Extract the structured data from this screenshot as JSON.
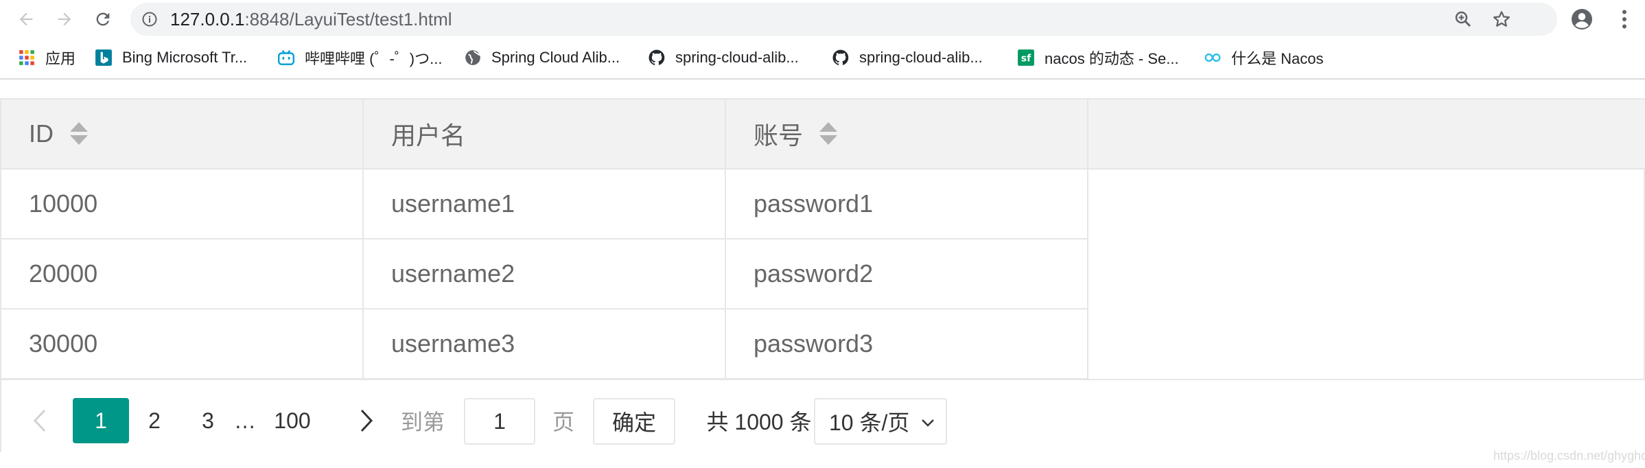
{
  "browser": {
    "url_host": "127.0.0.1",
    "url_path": ":8848/LayuiTest/test1.html"
  },
  "bookmarks": [
    {
      "label": "应用",
      "icon": "apps-grid-icon"
    },
    {
      "label": "Bing Microsoft Tr...",
      "icon": "bing-icon"
    },
    {
      "label": "哔哩哔哩 (゜-゜)つ...",
      "icon": "bilibili-icon"
    },
    {
      "label": "Spring Cloud Alib...",
      "icon": "globe-icon"
    },
    {
      "label": "spring-cloud-alib...",
      "icon": "github-icon"
    },
    {
      "label": "spring-cloud-alib...",
      "icon": "github-icon"
    },
    {
      "label": "nacos 的动态 - Se...",
      "icon": "segmentfault-icon"
    },
    {
      "label": "什么是 Nacos",
      "icon": "nacos-icon"
    }
  ],
  "table": {
    "headers": [
      "ID",
      "用户名",
      "账号"
    ],
    "rows": [
      [
        "10000",
        "username1",
        "password1"
      ],
      [
        "20000",
        "username2",
        "password2"
      ],
      [
        "30000",
        "username3",
        "password3"
      ]
    ]
  },
  "pagination": {
    "current": "1",
    "pages": [
      "2",
      "3"
    ],
    "ellipsis": "…",
    "last": "100",
    "skip_label": "到第",
    "skip_value": "1",
    "page_label": "页",
    "confirm": "确定",
    "total": "共 1000 条",
    "limit": "10 条/页"
  },
  "watermark": "https://blog.csdn.net/ghyghost",
  "colors": {
    "accent": "#009688",
    "header_bg": "#f2f2f2",
    "border": "#e6e6e6"
  }
}
